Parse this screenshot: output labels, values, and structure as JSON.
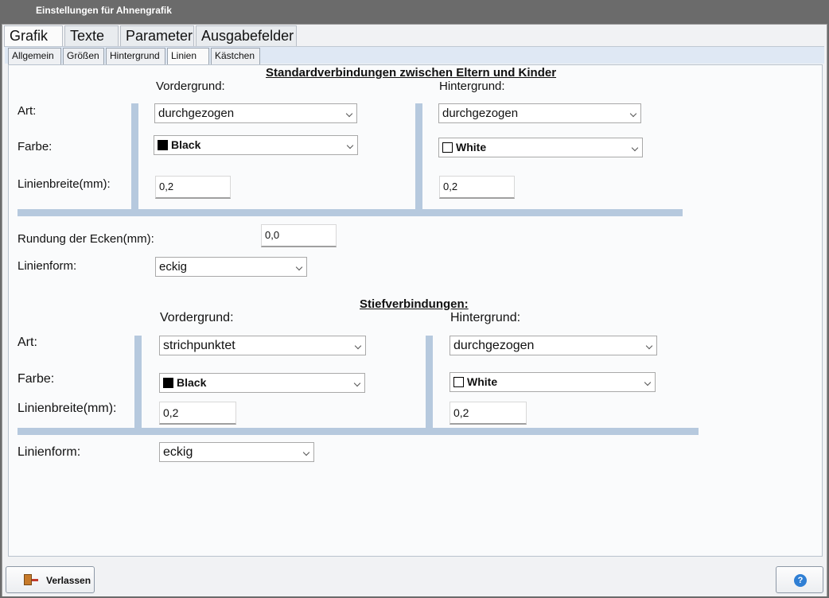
{
  "window": {
    "title": "Einstellungen für Ahnengrafik"
  },
  "main_tabs": [
    "Grafik",
    "Texte",
    "Parameter",
    "Ausgabefelder"
  ],
  "sub_tabs": [
    "Allgemein",
    "Größen",
    "Hintergrund",
    "Linien",
    "Kästchen"
  ],
  "std": {
    "heading": "Standardverbindungen zwischen Eltern und Kinder",
    "vordergrund": "Vordergrund:",
    "hintergrund": "Hintergrund:",
    "art_label": "Art:",
    "farbe_label": "Farbe:",
    "breite_label": "Linienbreite(mm):",
    "fg_art": "durchgezogen",
    "fg_farbe": "Black",
    "fg_breite": "0,2",
    "bg_art": "durchgezogen",
    "bg_farbe": "White",
    "bg_breite": "0,2",
    "rundung_label": "Rundung der Ecken(mm):",
    "rundung": "0,0",
    "form_label": "Linienform:",
    "form": "eckig"
  },
  "stief": {
    "heading": "Stiefverbindungen:",
    "vordergrund": "Vordergrund:",
    "hintergrund": "Hintergrund:",
    "art_label": "Art:",
    "farbe_label": "Farbe:",
    "breite_label": "Linienbreite(mm):",
    "fg_art": "strichpunktet",
    "fg_farbe": "Black",
    "fg_breite": "0,2",
    "bg_art": "durchgezogen",
    "bg_farbe": "White",
    "bg_breite": "0,2",
    "form_label": "Linienform:",
    "form": "eckig"
  },
  "buttons": {
    "exit": "Verlassen",
    "help_icon": "?"
  },
  "colors": {
    "black": "#000000",
    "white": "#ffffff",
    "bar": "#b6c9de"
  }
}
